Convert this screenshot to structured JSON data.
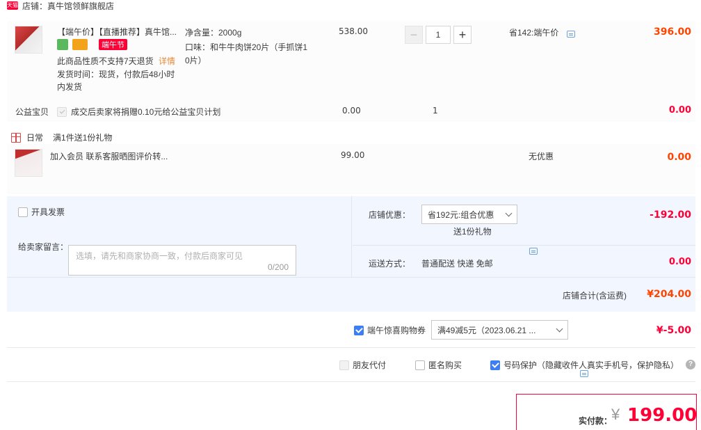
{
  "shop": {
    "badge": "天猫",
    "name": "店铺：真牛馆领鲜旗舰店"
  },
  "item1": {
    "title": "【端午价】【直播推荐】真牛馆...",
    "festival_tag": "端午节",
    "return_note": "此商品性质不支持7天退货",
    "return_link": "详情",
    "ship_line1": "发货时间：现货，付款后48小时",
    "ship_line2": "内发货",
    "spec_weight": "净含量：2000g",
    "spec_flavor1": "口味：和牛牛肉饼20片（手抓饼1",
    "spec_flavor2": "0片）",
    "unit_price": "538.00",
    "quantity": "1",
    "minus": "−",
    "plus": "+",
    "discount": "省142:端午价",
    "subtotal": "396.00"
  },
  "charity": {
    "label": "公益宝贝",
    "text": "成交后卖家将捐赠0.10元给公益宝贝计划",
    "price": "0.00",
    "qty": "1",
    "subtotal": "0.00"
  },
  "promo": {
    "label": "日常",
    "text": "满1件送1份礼物"
  },
  "item2": {
    "title": "加入会员 联系客服晒图评价转...",
    "price": "99.00",
    "discount": "无优惠",
    "subtotal": "0.00"
  },
  "order_panel": {
    "invoice_label": "开具发票",
    "message_label": "给卖家留言：",
    "message_placeholder": "选填，请先和商家协商一致，付款后商家可见",
    "message_count": "0/200",
    "shop_discount_label": "店铺优惠：",
    "shop_discount_value": "省192元:组合优惠",
    "gift_note": "送1份礼物",
    "shop_discount_amount": "-192.00",
    "shipping_label": "运送方式：",
    "shipping_value": "普通配送 快递 免邮",
    "shipping_amount": "0.00",
    "total_label": "店铺合计(含运费)",
    "total_value": "¥204.00"
  },
  "coupon": {
    "label": "端午惊喜购物券",
    "value": "满49减5元（2023.06.21 ...",
    "amount": "¥-5.00"
  },
  "options": {
    "friend_pay": "朋友代付",
    "anonymous": "匿名购买",
    "privacy": "号码保护（隐藏收件人真实手机号，保护隐私）",
    "help": "?"
  },
  "final": {
    "label": "实付款：",
    "currency": "¥",
    "amount": "199.00"
  },
  "colors": {
    "accent_red": "#ff0036",
    "price_orange": "#ff4400",
    "link_orange": "#e38b3a",
    "panel_bg": "#f2f7ff",
    "check_blue": "#3e7ef4"
  }
}
